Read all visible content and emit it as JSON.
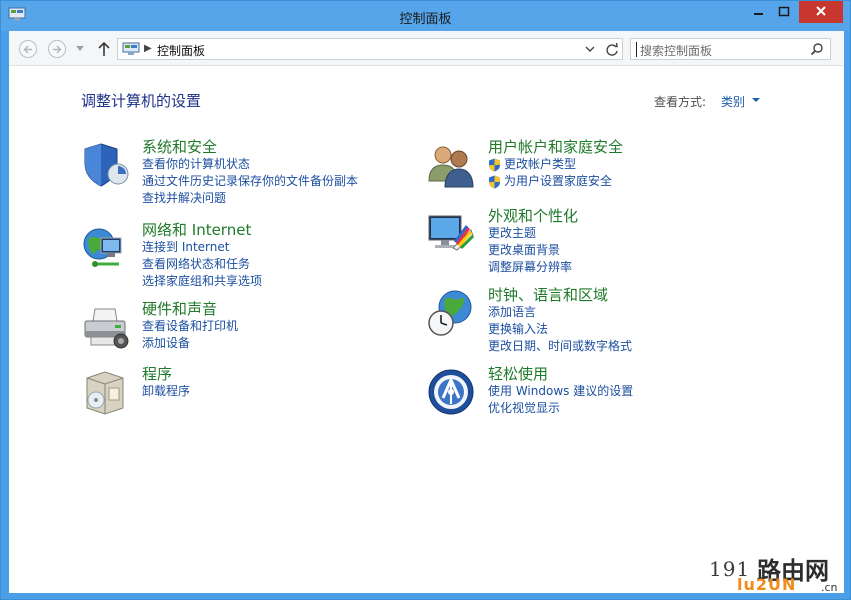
{
  "window": {
    "title": "控制面板"
  },
  "toolbar": {
    "address_text": "控制面板",
    "search_placeholder": "搜索控制面板"
  },
  "header": {
    "page_title": "调整计算机的设置",
    "view_label": "查看方式:",
    "view_value": "类别"
  },
  "categories": [
    {
      "title": "系统和安全",
      "icon": "shield-icon",
      "links": [
        "查看你的计算机状态",
        "通过文件历史记录保存你的文件备份副本",
        "查找并解决问题"
      ]
    },
    {
      "title": "网络和 Internet",
      "icon": "network-globe-icon",
      "links": [
        "连接到 Internet",
        "查看网络状态和任务",
        "选择家庭组和共享选项"
      ]
    },
    {
      "title": "硬件和声音",
      "icon": "printer-icon",
      "links": [
        "查看设备和打印机",
        "添加设备"
      ]
    },
    {
      "title": "程序",
      "icon": "programs-box-icon",
      "links": [
        "卸载程序"
      ]
    },
    {
      "title": "用户帐户和家庭安全",
      "icon": "users-icon",
      "links": [
        "更改帐户类型",
        "为用户设置家庭安全"
      ]
    },
    {
      "title": "外观和个性化",
      "icon": "monitor-palette-icon",
      "links": [
        "更改主题",
        "更改桌面背景",
        "调整屏幕分辨率"
      ]
    },
    {
      "title": "时钟、语言和区域",
      "icon": "clock-globe-icon",
      "links": [
        "添加语言",
        "更换输入法",
        "更改日期、时间或数字格式"
      ]
    },
    {
      "title": "轻松使用",
      "icon": "ease-of-access-icon",
      "links": [
        "使用 Windows 建议的设置",
        "优化视觉显示"
      ]
    }
  ],
  "watermark": {
    "number": "191",
    "chinese": "路由网",
    "latin": "lu2UN",
    "domain": ".cn"
  },
  "colors": {
    "titlebar": "#56a5ea",
    "category_title": "#1f7a2a",
    "link": "#1c4fa0",
    "page_title": "#1e3287"
  }
}
